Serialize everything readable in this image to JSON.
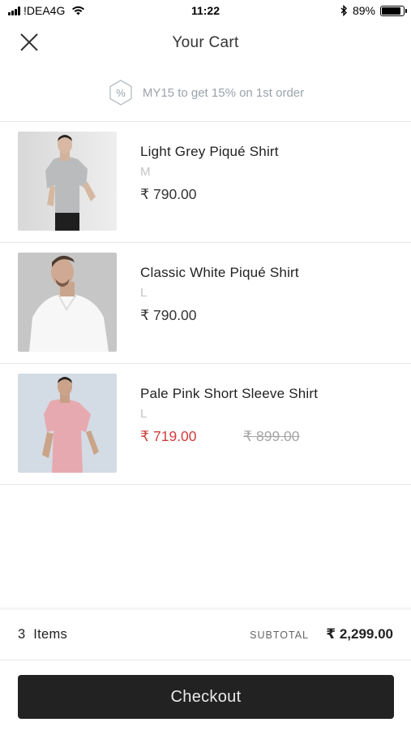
{
  "status_bar": {
    "carrier": "!DEA4G",
    "time": "11:22",
    "battery": "89%",
    "battery_level": 0.89
  },
  "header": {
    "title": "Your Cart",
    "close_icon": "close-icon"
  },
  "promo": {
    "icon": "percent-badge-icon",
    "text": "MY15 to get 15% on 1st order"
  },
  "cart": {
    "items": [
      {
        "name": "Light Grey Piqué Shirt",
        "size": "M",
        "price": "₹ 790.00",
        "shirt_color": "#b9bbbd",
        "bg_color": "#e6e6e6"
      },
      {
        "name": "Classic White Piqué Shirt",
        "size": "L",
        "price": "₹ 790.00",
        "shirt_color": "#f7f7f7",
        "bg_color": "#c9c9c9"
      },
      {
        "name": "Pale Pink Short Sleeve Shirt",
        "size": "L",
        "price": "₹ 719.00",
        "old_price": "₹ 899.00",
        "shirt_color": "#e7a9b0",
        "bg_color": "#d5dde6"
      }
    ]
  },
  "footer": {
    "items_count": "3  Items",
    "subtotal_label": "SUBTOTAL",
    "subtotal_value": "₹ 2,299.00",
    "checkout_label": "Checkout"
  },
  "colors": {
    "sale_price": "#cf3c3c",
    "checkout_bg": "#222222",
    "promo_text": "#9aa3ab"
  }
}
